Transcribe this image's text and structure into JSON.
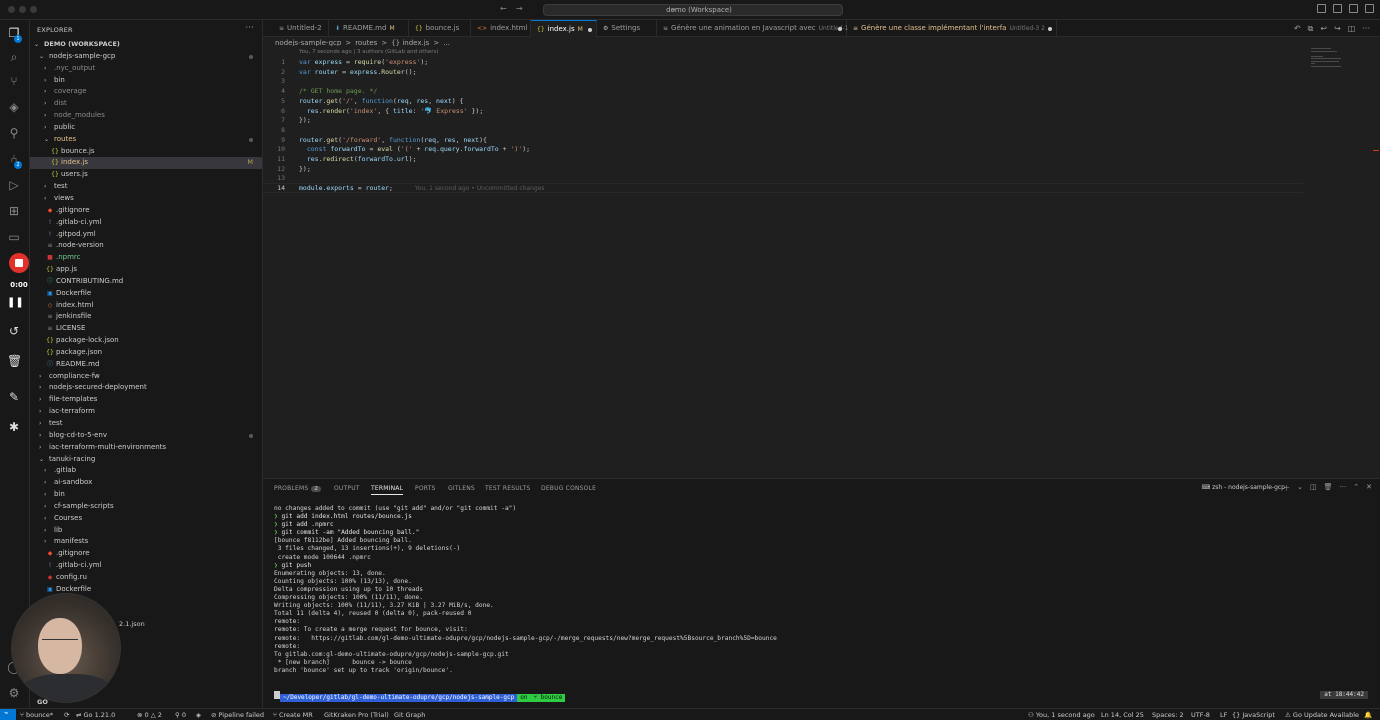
{
  "titlebar": {
    "title": "demo (Workspace)"
  },
  "recorder": {
    "time": "0:00"
  },
  "sidebar": {
    "title": "EXPLORER",
    "tree": [
      {
        "label": "DEMO (WORKSPACE)",
        "depth": 0,
        "kind": "root",
        "expanded": true
      },
      {
        "label": "nodejs-sample-gcp",
        "depth": 1,
        "kind": "folder",
        "expanded": true,
        "dot": true
      },
      {
        "label": ".nyc_output",
        "depth": 2,
        "kind": "folder",
        "dim": true
      },
      {
        "label": "bin",
        "depth": 2,
        "kind": "folder"
      },
      {
        "label": "coverage",
        "depth": 2,
        "kind": "folder",
        "dim": true
      },
      {
        "label": "dist",
        "depth": 2,
        "kind": "folder",
        "dim": true
      },
      {
        "label": "node_modules",
        "depth": 2,
        "kind": "folder",
        "dim": true
      },
      {
        "label": "public",
        "depth": 2,
        "kind": "folder"
      },
      {
        "label": "routes",
        "depth": 2,
        "kind": "folder",
        "expanded": true,
        "dot": true,
        "color": "yellow"
      },
      {
        "label": "bounce.js",
        "depth": 3,
        "kind": "js"
      },
      {
        "label": "index.js",
        "depth": 3,
        "kind": "js",
        "selected": true,
        "mod": "M",
        "color": "yellow"
      },
      {
        "label": "users.js",
        "depth": 3,
        "kind": "js"
      },
      {
        "label": "test",
        "depth": 2,
        "kind": "folder"
      },
      {
        "label": "views",
        "depth": 2,
        "kind": "folder"
      },
      {
        "label": ".gitignore",
        "depth": 2,
        "kind": "git"
      },
      {
        "label": ".gitlab-ci.yml",
        "depth": 2,
        "kind": "yml"
      },
      {
        "label": ".gitpod.yml",
        "depth": 2,
        "kind": "yml"
      },
      {
        "label": ".node-version",
        "depth": 2,
        "kind": "txt"
      },
      {
        "label": ".npmrc",
        "depth": 2,
        "kind": "npm",
        "color": "green"
      },
      {
        "label": "app.js",
        "depth": 2,
        "kind": "js"
      },
      {
        "label": "CONTRIBUTING.md",
        "depth": 2,
        "kind": "md"
      },
      {
        "label": "Dockerfile",
        "depth": 2,
        "kind": "docker"
      },
      {
        "label": "index.html",
        "depth": 2,
        "kind": "html"
      },
      {
        "label": "jenkinsfile",
        "depth": 2,
        "kind": "txt"
      },
      {
        "label": "LICENSE",
        "depth": 2,
        "kind": "txt"
      },
      {
        "label": "package-lock.json",
        "depth": 2,
        "kind": "json"
      },
      {
        "label": "package.json",
        "depth": 2,
        "kind": "json"
      },
      {
        "label": "README.md",
        "depth": 2,
        "kind": "md"
      },
      {
        "label": "compliance-fw",
        "depth": 1,
        "kind": "folder"
      },
      {
        "label": "nodejs-secured-deployment",
        "depth": 1,
        "kind": "folder"
      },
      {
        "label": "file-templates",
        "depth": 1,
        "kind": "folder"
      },
      {
        "label": "iac-terraform",
        "depth": 1,
        "kind": "folder"
      },
      {
        "label": "test",
        "depth": 1,
        "kind": "folder"
      },
      {
        "label": "blog-cd-to-5-env",
        "depth": 1,
        "kind": "folder",
        "dot": true
      },
      {
        "label": "iac-terraform-multi-environments",
        "depth": 1,
        "kind": "folder"
      },
      {
        "label": "tanuki-racing",
        "depth": 1,
        "kind": "folder",
        "expanded": true
      },
      {
        "label": ".gitlab",
        "depth": 2,
        "kind": "folder"
      },
      {
        "label": "ai-sandbox",
        "depth": 2,
        "kind": "folder"
      },
      {
        "label": "bin",
        "depth": 2,
        "kind": "folder"
      },
      {
        "label": "cf-sample-scripts",
        "depth": 2,
        "kind": "folder"
      },
      {
        "label": "Courses",
        "depth": 2,
        "kind": "folder"
      },
      {
        "label": "lib",
        "depth": 2,
        "kind": "folder"
      },
      {
        "label": "manifests",
        "depth": 2,
        "kind": "folder"
      },
      {
        "label": ".gitignore",
        "depth": 2,
        "kind": "git"
      },
      {
        "label": ".gitlab-ci.yml",
        "depth": 2,
        "kind": "yml"
      },
      {
        "label": "config.ru",
        "depth": 2,
        "kind": "ruby"
      },
      {
        "label": "Dockerfile",
        "depth": 2,
        "kind": "docker"
      }
    ],
    "partial": {
      "json_suffix": "2.1.json",
      "bottom_label": "GO"
    }
  },
  "tabs": [
    {
      "label": "Untitled-2",
      "icon": "txt"
    },
    {
      "label": "README.md",
      "icon": "md",
      "mod": "M"
    },
    {
      "label": "bounce.js",
      "icon": "js"
    },
    {
      "label": "index.html",
      "icon": "html"
    },
    {
      "label": "index.js",
      "icon": "js",
      "mod": "M",
      "active": true,
      "dirty": true
    },
    {
      "label": "Settings",
      "icon": "gear"
    },
    {
      "label": "Génère une animation en Javascript avec",
      "icon": "txt",
      "sub": "Untitled-1",
      "dirty": true
    },
    {
      "label": "Génère une classe implémentant l'interfa",
      "icon": "txt",
      "sub": "Untitled-3 2",
      "dirty": true,
      "color": "yellow"
    }
  ],
  "breadcrumb": [
    "nodejs-sample-gcp",
    ">",
    "routes",
    ">",
    "{} index.js",
    ">",
    "..."
  ],
  "editor": {
    "blame_header": "You, 7 seconds ago | 3 authors (GitLab and others)",
    "line_numbers": [
      "1",
      "2",
      "3",
      "4",
      "5",
      "6",
      "7",
      "8",
      "9",
      "10",
      "11",
      "12",
      "13",
      "14"
    ],
    "current_line": 14,
    "inline_blame": "You, 1 second ago • Uncommitted changes"
  },
  "panel": {
    "tabs": [
      "PROBLEMS",
      "OUTPUT",
      "TERMINAL",
      "PORTS",
      "GITLENS",
      "TEST RESULTS",
      "DEBUG CONSOLE"
    ],
    "active_tab": "TERMINAL",
    "problems_count": "2",
    "terminal_name": "zsh - nodejs-sample-gcp",
    "lines": [
      "no changes added to commit (use \"git add\" and/or \"git commit -a\")",
      "❯ git add index.html routes/bounce.js",
      "❯ git add .npmrc",
      "❯ git commit -am \"Added bouncing ball.\"",
      "[bounce f8112be] Added bouncing ball.",
      " 3 files changed, 13 insertions(+), 9 deletions(-)",
      " create mode 100644 .npmrc",
      "❯ git push",
      "Enumerating objects: 13, done.",
      "Counting objects: 100% (13/13), done.",
      "Delta compression using up to 10 threads",
      "Compressing objects: 100% (11/11), done.",
      "Writing objects: 100% (11/11), 3.27 KiB | 3.27 MiB/s, done.",
      "Total 11 (delta 4), reused 0 (delta 0), pack-reused 0",
      "remote:",
      "remote: To create a merge request for bounce, visit:",
      "remote:   https://gitlab.com/gl-demo-ultimate-odupre/gcp/nodejs-sample-gcp/-/merge_requests/new?merge_request%5Bsource_branch%5D=bounce",
      "remote:",
      "To gitlab.com:gl-demo-ultimate-odupre/gcp/nodejs-sample-gcp.git",
      " * [new branch]      bounce -> bounce",
      "branch 'bounce' set up to track 'origin/bounce'."
    ],
    "prompt": {
      "path": "~/Developer/gitlab/gl-demo-ultimate-odupre/gcp/nodejs-sample-gcp",
      "git_on": "on",
      "branch": "bounce",
      "time": "at 18:44:42"
    }
  },
  "statusbar": {
    "branch": "bounce*",
    "go_version": "Go 1.21.0",
    "problems": "0 △ 2",
    "ports": "0",
    "pipeline": "Pipeline failed",
    "create_mr": "Create MR",
    "gitkraken": "GitKraken Pro (Trial)",
    "git_graph": "Git Graph",
    "blame": "You, 1 second ago",
    "position": "Ln 14, Col 25",
    "spaces": "Spaces: 2",
    "encoding": "UTF-8",
    "eol": "LF",
    "language": "JavaScript",
    "go_update": "Go Update Available"
  }
}
